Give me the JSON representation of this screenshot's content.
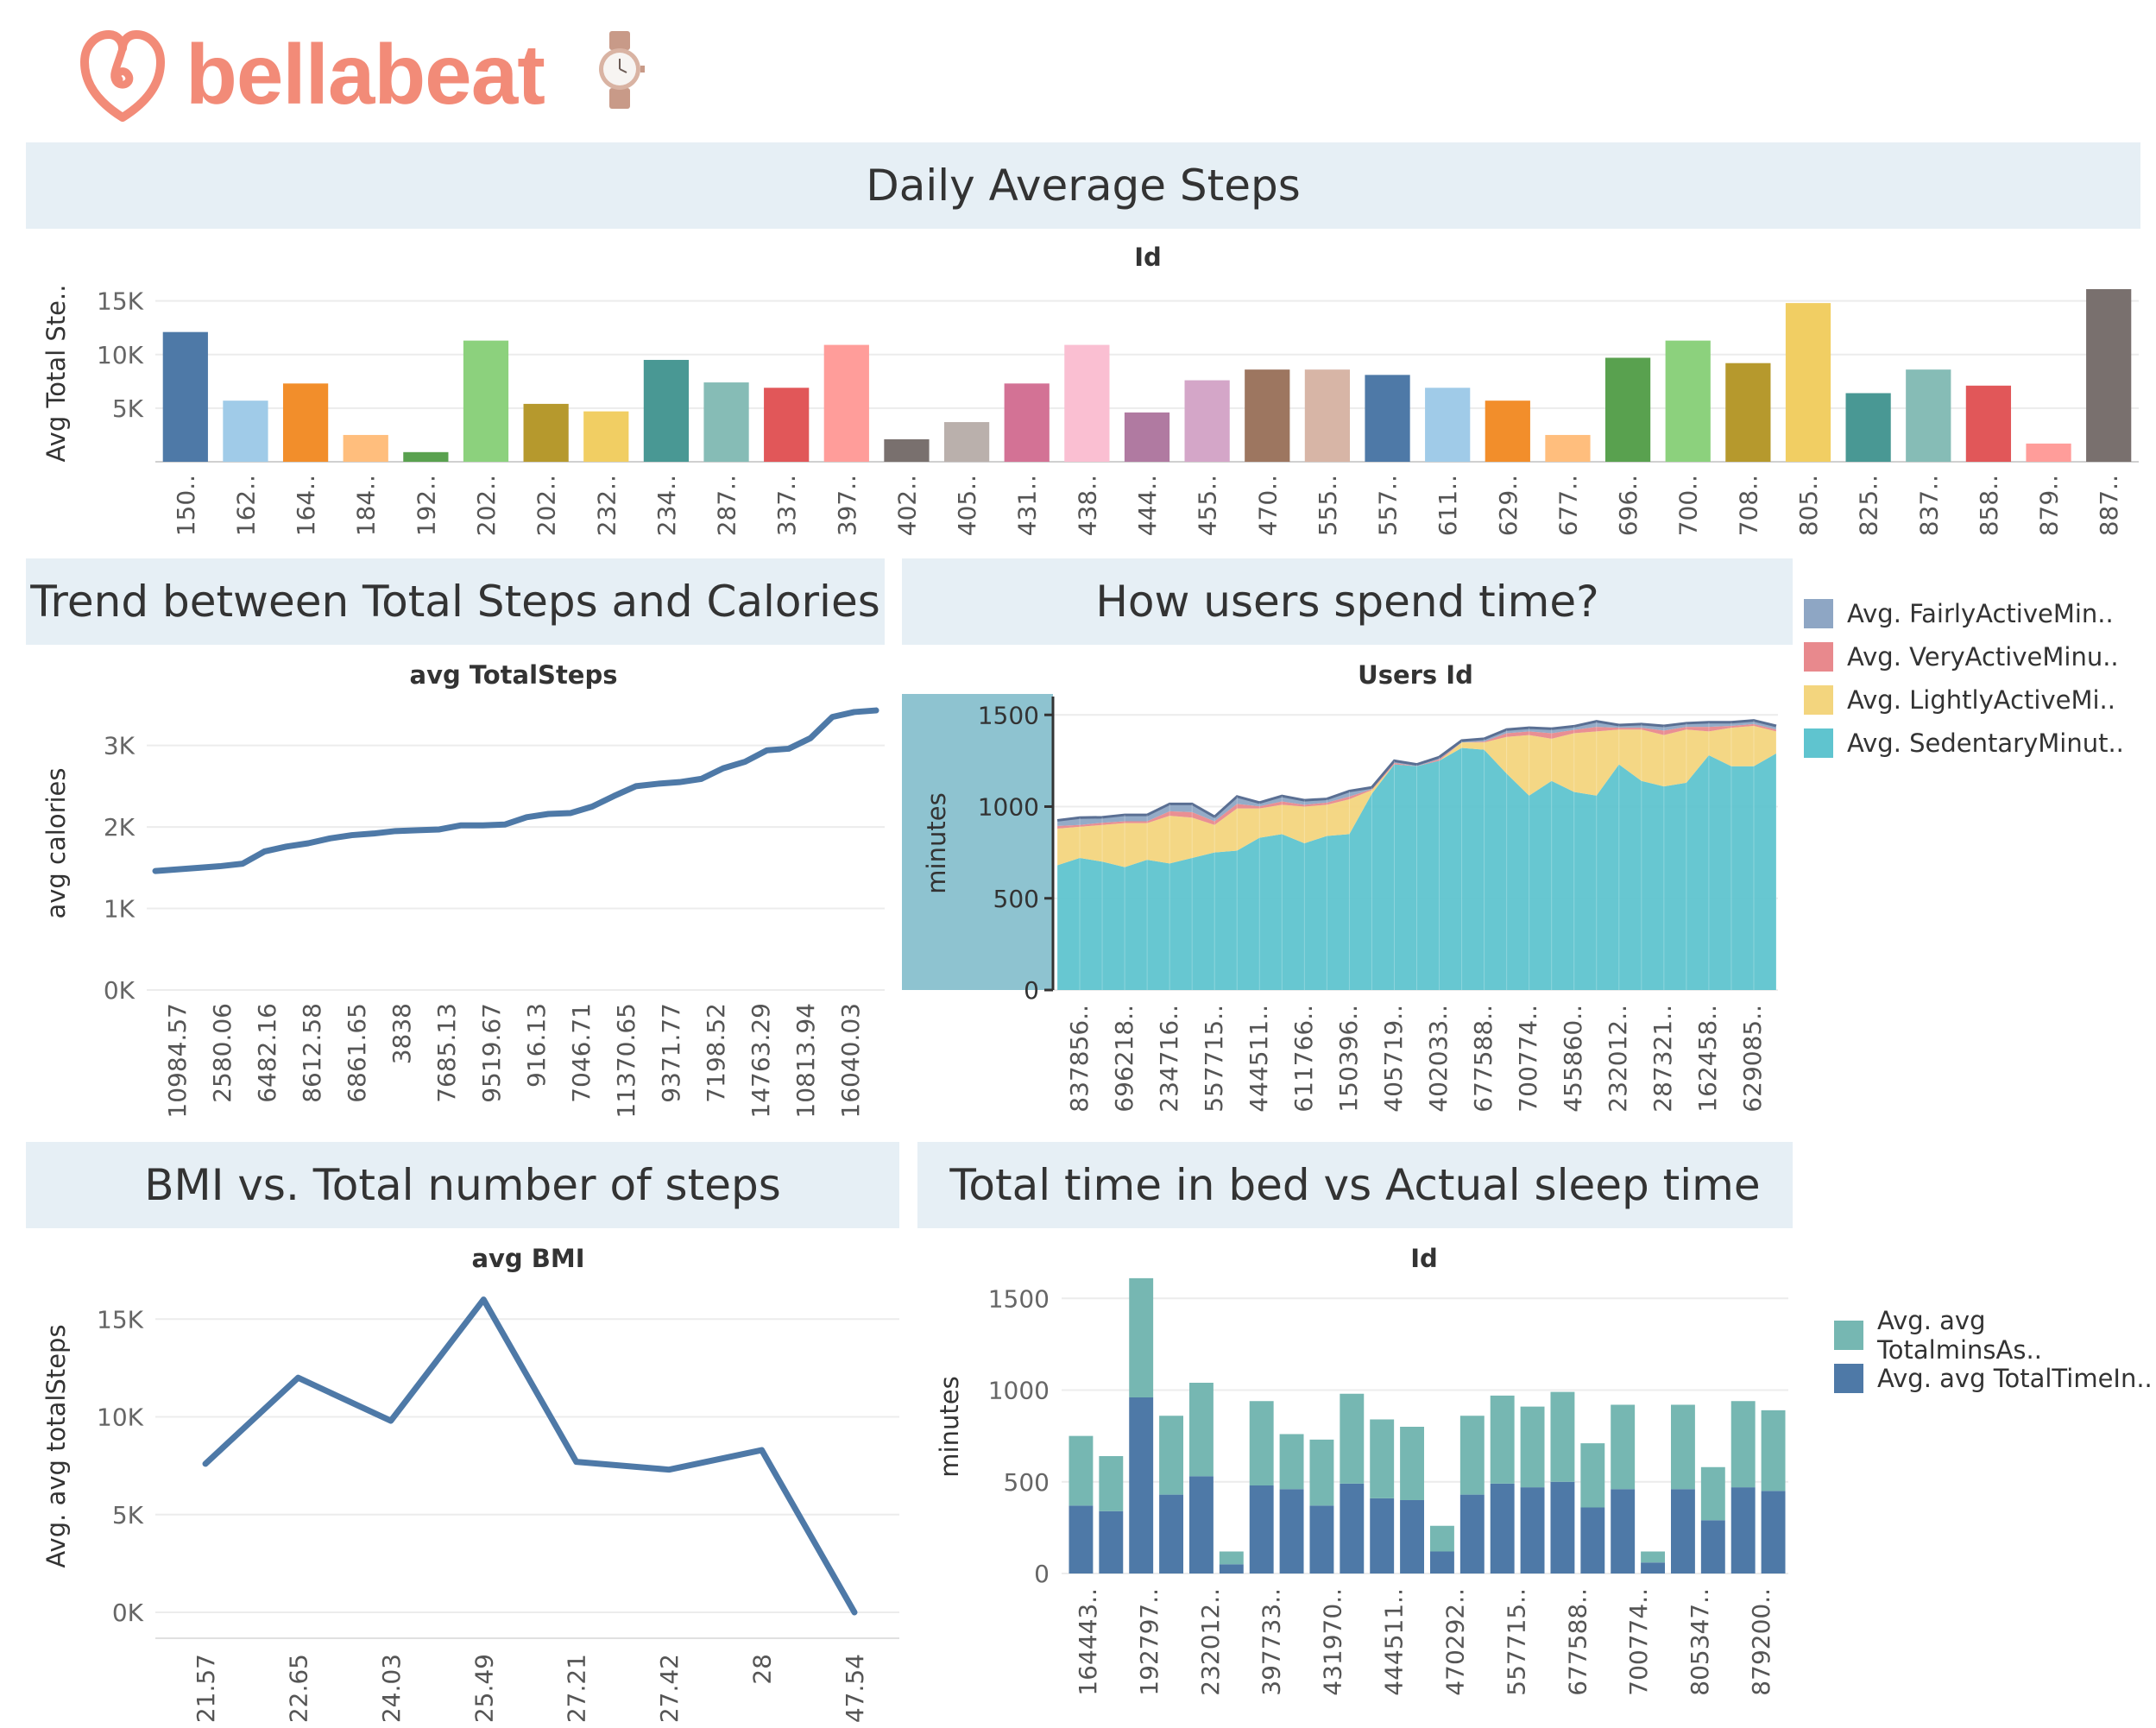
{
  "header": {
    "brand": "bellabeat",
    "logo_icon": "bellabeat-heart-logo-icon",
    "watch_icon": "watch-icon",
    "brand_color": "#f28b78"
  },
  "banners": {
    "daily_steps": "Daily Average Steps",
    "steps_calories": "Trend between Total Steps and Calories",
    "time_spend": "How users spend time?",
    "bmi_steps": "BMI vs. Total number of steps",
    "sleep": "Total time in bed vs  Actual sleep time"
  },
  "chart_data": [
    {
      "id": "daily_steps",
      "type": "bar",
      "title": "Id",
      "ylabel": "Avg Total Ste..",
      "ylim": [
        0,
        16500
      ],
      "yticks": [
        5000,
        10000,
        15000
      ],
      "ytick_labels": [
        "5K",
        "10K",
        "15K"
      ],
      "categories": [
        "150..",
        "162..",
        "164..",
        "184..",
        "192..",
        "202..",
        "202..",
        "232..",
        "234..",
        "287..",
        "337..",
        "397..",
        "402..",
        "405..",
        "431..",
        "438..",
        "444..",
        "455..",
        "470..",
        "555..",
        "557..",
        "611..",
        "629..",
        "677..",
        "696..",
        "700..",
        "708..",
        "805..",
        "825..",
        "837..",
        "858..",
        "879..",
        "887.."
      ],
      "values": [
        12100,
        5700,
        7300,
        2500,
        900,
        11300,
        5400,
        4700,
        9500,
        7400,
        6900,
        10900,
        2100,
        3700,
        7300,
        10900,
        4600,
        7600,
        8600,
        8600,
        8100,
        6900,
        5700,
        2500,
        9700,
        11300,
        9200,
        14800,
        6400,
        8600,
        7100,
        1700,
        16100
      ],
      "colors": [
        "#4e79a7",
        "#a0cbe8",
        "#f28e2b",
        "#ffbe7d",
        "#59a14f",
        "#8cd17d",
        "#b6992d",
        "#f1ce63",
        "#499894",
        "#86bcb6",
        "#e15759",
        "#ff9d9a",
        "#79706e",
        "#bab0ac",
        "#d37295",
        "#fabfd2",
        "#b07aa1",
        "#d4a6c8",
        "#9d7660",
        "#d7b5a6",
        "#4e79a7",
        "#a0cbe8",
        "#f28e2b",
        "#ffbe7d",
        "#59a14f",
        "#8cd17d",
        "#b6992d",
        "#f1ce63",
        "#499894",
        "#86bcb6",
        "#e15759",
        "#ff9d9a",
        "#79706e"
      ]
    },
    {
      "id": "steps_calories",
      "type": "line",
      "title": "avg TotalSteps",
      "ylabel": "avg calories",
      "ylim": [
        0,
        3600
      ],
      "yticks": [
        0,
        1000,
        2000,
        3000
      ],
      "ytick_labels": [
        "0K",
        "1K",
        "2K",
        "3K"
      ],
      "categories": [
        "10984.57",
        "2580.06",
        "6482.16",
        "8612.58",
        "6861.65",
        "3838",
        "7685.13",
        "9519.67",
        "916.13",
        "7046.71",
        "11370.65",
        "9371.77",
        "7198.52",
        "14763.29",
        "10813.94",
        "16040.03"
      ],
      "values": [
        1460,
        1480,
        1500,
        1520,
        1550,
        1700,
        1760,
        1800,
        1860,
        1900,
        1920,
        1950,
        1960,
        1970,
        2020,
        2020,
        2030,
        2120,
        2160,
        2170,
        2250,
        2380,
        2500,
        2530,
        2550,
        2590,
        2720,
        2800,
        2940,
        2960,
        3090,
        3350,
        3410,
        3430
      ],
      "color": "#4e79a7"
    },
    {
      "id": "time_spend",
      "type": "area",
      "title": "Users Id",
      "ylabel": "minutes",
      "ylim": [
        0,
        1600
      ],
      "yticks": [
        0,
        500,
        1000,
        1500
      ],
      "ytick_labels": [
        "0",
        "500",
        "1000",
        "1500"
      ],
      "categories": [
        "837856..",
        "696218..",
        "234716..",
        "557715..",
        "444511..",
        "611766..",
        "150396..",
        "405719..",
        "402033..",
        "677588..",
        "700774..",
        "455860..",
        "232012..",
        "287321..",
        "162458..",
        "629085.."
      ],
      "series": [
        {
          "name": "Avg. SedentaryMinut..",
          "color": "#5fc4cf",
          "values": [
            680,
            720,
            700,
            670,
            710,
            690,
            720,
            750,
            760,
            830,
            850,
            800,
            840,
            850,
            1070,
            1230,
            1220,
            1250,
            1320,
            1310,
            1180,
            1060,
            1140,
            1080,
            1060,
            1230,
            1140,
            1110,
            1130,
            1280,
            1220,
            1220,
            1290
          ]
        },
        {
          "name": "Avg. LightlyActiveMi..",
          "color": "#f3d57e",
          "values": [
            200,
            170,
            200,
            240,
            200,
            260,
            220,
            150,
            230,
            160,
            160,
            200,
            170,
            190,
            20,
            0,
            0,
            0,
            30,
            40,
            200,
            330,
            230,
            320,
            350,
            190,
            280,
            280,
            290,
            130,
            210,
            220,
            120
          ]
        },
        {
          "name": "Avg. VeryActiveMinu..",
          "color": "#e8898d",
          "values": [
            15,
            10,
            12,
            10,
            10,
            25,
            30,
            20,
            25,
            12,
            18,
            10,
            12,
            15,
            5,
            8,
            0,
            8,
            0,
            5,
            20,
            20,
            30,
            18,
            25,
            10,
            10,
            25,
            15,
            25,
            10,
            10,
            10
          ]
        },
        {
          "name": "Avg. FairlyActiveMin..",
          "color": "#8ea6c4",
          "values": [
            30,
            40,
            30,
            35,
            35,
            40,
            45,
            25,
            40,
            20,
            30,
            25,
            20,
            30,
            10,
            12,
            10,
            12,
            10,
            15,
            20,
            20,
            25,
            20,
            30,
            15,
            20,
            25,
            20,
            25,
            20,
            20,
            20
          ]
        }
      ],
      "legend": "right"
    },
    {
      "id": "bmi_steps",
      "type": "line",
      "title": "avg BMI",
      "ylabel": "Avg. avg totalSteps",
      "ylim": [
        0,
        17000
      ],
      "yticks": [
        0,
        5000,
        10000,
        15000
      ],
      "ytick_labels": [
        "0K",
        "5K",
        "10K",
        "15K"
      ],
      "categories": [
        "21.57",
        "22.65",
        "24.03",
        "25.49",
        "27.21",
        "27.42",
        "28",
        "47.54"
      ],
      "values": [
        7600,
        12000,
        9800,
        16000,
        7700,
        7300,
        8300,
        0
      ],
      "color": "#4e79a7"
    },
    {
      "id": "sleep",
      "type": "bar",
      "title": "Id",
      "ylabel": "minutes",
      "ylim": [
        0,
        1600
      ],
      "yticks": [
        0,
        500,
        1000,
        1500
      ],
      "ytick_labels": [
        "0",
        "500",
        "1000",
        "1500"
      ],
      "categories": [
        "164443..",
        "192797..",
        "232012..",
        "397733..",
        "431970..",
        "444511..",
        "470292..",
        "557715..",
        "677588..",
        "700774..",
        "805347..",
        "879200.."
      ],
      "series": [
        {
          "name": "Avg. avg TotalTimeIn..",
          "color": "#4e79a7",
          "values": [
            370,
            340,
            960,
            430,
            530,
            50,
            480,
            460,
            370,
            490,
            410,
            400,
            120,
            430,
            490,
            470,
            500,
            360,
            460,
            60,
            460,
            290,
            470,
            450
          ]
        },
        {
          "name": "Avg. avg TotalminsAs..",
          "color": "#76b7b2",
          "values": [
            380,
            300,
            650,
            430,
            510,
            70,
            460,
            300,
            360,
            490,
            430,
            400,
            140,
            430,
            480,
            440,
            490,
            350,
            460,
            60,
            460,
            290,
            470,
            440
          ]
        }
      ],
      "legend": "right"
    }
  ]
}
